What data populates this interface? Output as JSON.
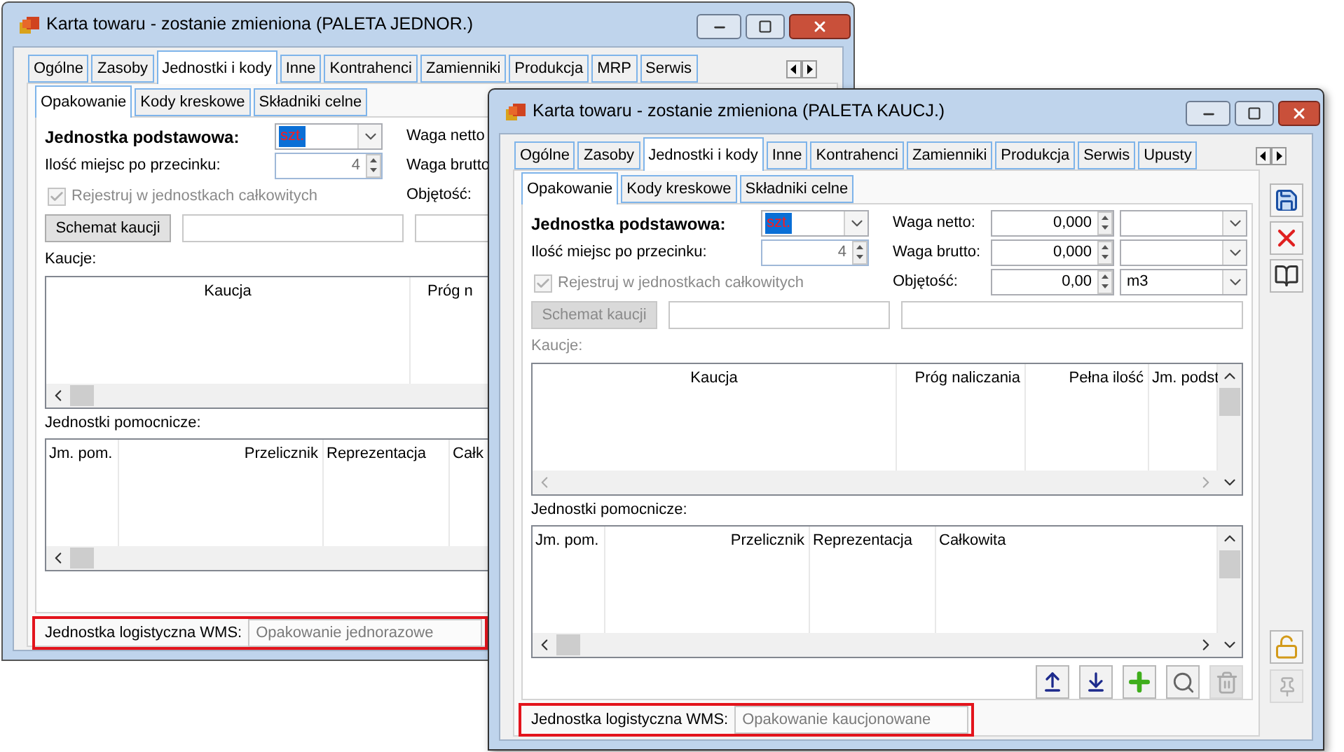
{
  "windows": [
    {
      "active": false,
      "title": "Karta towaru - zostanie zmieniona (PALETA JEDNOR.)",
      "tabs": [
        {
          "label": "Ogólne",
          "selected": false
        },
        {
          "label": "Zasoby",
          "selected": false
        },
        {
          "label": "Jednostki i kody",
          "selected": true
        },
        {
          "label": "Inne",
          "selected": false
        },
        {
          "label": "Kontrahenci",
          "selected": false
        },
        {
          "label": "Zamienniki",
          "selected": false
        },
        {
          "label": "Produkcja",
          "selected": false
        },
        {
          "label": "MRP",
          "selected": false
        },
        {
          "label": "Serwis",
          "selected": false
        }
      ],
      "subtabs": [
        {
          "label": "Opakowanie",
          "selected": true
        },
        {
          "label": "Kody kreskowe",
          "selected": false
        },
        {
          "label": "Składniki celne",
          "selected": false
        }
      ],
      "base_unit": {
        "label": "Jednostka podstawowa:",
        "value": "szt.",
        "selected": true
      },
      "decimals": {
        "label": "Ilość miejsc po przecinku:",
        "value": "4"
      },
      "weights": [
        {
          "label": "Waga netto"
        },
        {
          "label": "Waga brutto"
        },
        {
          "label": "Objętość:"
        }
      ],
      "register_whole": {
        "label": "Rejestruj w jednostkach całkowitych",
        "checked": true,
        "disabled": true
      },
      "deposit_scheme": {
        "label": "Schemat kaucji",
        "disabled": false
      },
      "deposits": {
        "label": "Kaucje:",
        "disabled": false,
        "columns": [
          "Kaucja",
          "Próg n"
        ]
      },
      "aux_units": {
        "label": "Jednostki pomocnicze:",
        "columns": [
          "Jm. pom.",
          "Przelicznik",
          "Reprezentacja",
          "Całk"
        ]
      },
      "wms": {
        "label": "Jednostka logistyczna WMS:",
        "value": "Opakowanie jednorazowe",
        "disabled": true
      }
    },
    {
      "active": true,
      "title": "Karta towaru - zostanie zmieniona (PALETA KAUCJ.)",
      "tabs": [
        {
          "label": "Ogólne",
          "selected": false
        },
        {
          "label": "Zasoby",
          "selected": false
        },
        {
          "label": "Jednostki i kody",
          "selected": true
        },
        {
          "label": "Inne",
          "selected": false
        },
        {
          "label": "Kontrahenci",
          "selected": false
        },
        {
          "label": "Zamienniki",
          "selected": false
        },
        {
          "label": "Produkcja",
          "selected": false
        },
        {
          "label": "Serwis",
          "selected": false
        },
        {
          "label": "Upusty",
          "selected": false
        }
      ],
      "subtabs": [
        {
          "label": "Opakowanie",
          "selected": true
        },
        {
          "label": "Kody kreskowe",
          "selected": false
        },
        {
          "label": "Składniki celne",
          "selected": false
        }
      ],
      "base_unit": {
        "label": "Jednostka podstawowa:",
        "value": "szt.",
        "selected": true
      },
      "decimals": {
        "label": "Ilość miejsc po przecinku:",
        "value": "4"
      },
      "weights": [
        {
          "label": "Waga netto:",
          "value": "0,000"
        },
        {
          "label": "Waga brutto:",
          "value": "0,000"
        },
        {
          "label": "Objętość:",
          "value": "0,00",
          "unit": "m3"
        }
      ],
      "register_whole": {
        "label": "Rejestruj w jednostkach całkowitych",
        "checked": true,
        "disabled": true
      },
      "deposit_scheme": {
        "label": "Schemat kaucji",
        "disabled": true
      },
      "deposits": {
        "label": "Kaucje:",
        "disabled": true,
        "columns": [
          "Kaucja",
          "Próg naliczania",
          "Pełna ilość",
          "Jm. podst"
        ]
      },
      "aux_units": {
        "label": "Jednostki pomocnicze:",
        "columns": [
          "Jm. pom.",
          "Przelicznik",
          "Reprezentacja",
          "Całkowita"
        ]
      },
      "grid_toolbar": [
        {
          "kind": "move_up",
          "disabled": false
        },
        {
          "kind": "move_down",
          "disabled": false
        },
        {
          "kind": "add",
          "disabled": false
        },
        {
          "kind": "search",
          "disabled": false
        },
        {
          "kind": "delete",
          "disabled": true
        }
      ],
      "side_toolbar": {
        "top": [
          {
            "kind": "save",
            "disabled": false
          },
          {
            "kind": "delete",
            "disabled": false
          },
          {
            "kind": "book",
            "disabled": false
          }
        ],
        "bottom": [
          {
            "kind": "lock",
            "disabled": false
          },
          {
            "kind": "pin",
            "disabled": true
          }
        ]
      },
      "wms": {
        "label": "Jednostka logistyczna WMS:",
        "value": "Opakowanie kaucjonowane",
        "disabled": true
      }
    }
  ]
}
